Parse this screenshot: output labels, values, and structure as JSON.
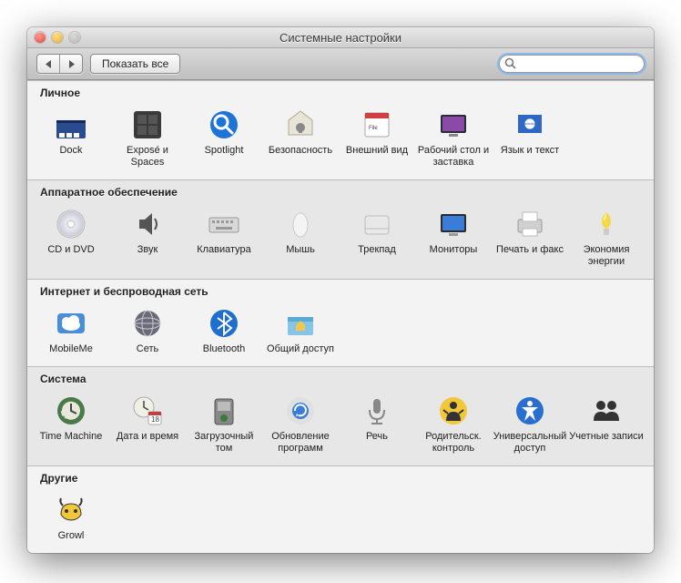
{
  "window": {
    "title": "Системные настройки"
  },
  "toolbar": {
    "showAll": "Показать все",
    "searchPlaceholder": ""
  },
  "sections": {
    "personal": {
      "title": "Личное",
      "items": [
        {
          "id": "dock",
          "label": "Dock"
        },
        {
          "id": "expose",
          "label": "Exposé и Spaces"
        },
        {
          "id": "spotlight",
          "label": "Spotlight"
        },
        {
          "id": "security",
          "label": "Безопасность"
        },
        {
          "id": "appearance",
          "label": "Внешний вид"
        },
        {
          "id": "desktop",
          "label": "Рабочий стол и заставка"
        },
        {
          "id": "language",
          "label": "Язык и текст"
        }
      ]
    },
    "hardware": {
      "title": "Аппаратное обеспечение",
      "items": [
        {
          "id": "cddvd",
          "label": "CD и DVD"
        },
        {
          "id": "sound",
          "label": "Звук"
        },
        {
          "id": "keyboard",
          "label": "Клавиатура"
        },
        {
          "id": "mouse",
          "label": "Мышь"
        },
        {
          "id": "trackpad",
          "label": "Трекпад"
        },
        {
          "id": "displays",
          "label": "Мониторы"
        },
        {
          "id": "print",
          "label": "Печать и факс"
        },
        {
          "id": "energy",
          "label": "Экономия энергии"
        }
      ]
    },
    "internet": {
      "title": "Интернет и беспроводная сеть",
      "items": [
        {
          "id": "mobileme",
          "label": "MobileMe"
        },
        {
          "id": "network",
          "label": "Сеть"
        },
        {
          "id": "bluetooth",
          "label": "Bluetooth"
        },
        {
          "id": "sharing",
          "label": "Общий доступ"
        }
      ]
    },
    "system": {
      "title": "Система",
      "items": [
        {
          "id": "timemachine",
          "label": "Time Machine"
        },
        {
          "id": "datetime",
          "label": "Дата и время"
        },
        {
          "id": "startup",
          "label": "Загрузочный том"
        },
        {
          "id": "update",
          "label": "Обновление программ"
        },
        {
          "id": "speech",
          "label": "Речь"
        },
        {
          "id": "parental",
          "label": "Родительск. контроль"
        },
        {
          "id": "accessibility",
          "label": "Универсальный доступ"
        },
        {
          "id": "accounts",
          "label": "Учетные записи"
        }
      ]
    },
    "other": {
      "title": "Другие",
      "items": [
        {
          "id": "growl",
          "label": "Growl"
        }
      ]
    }
  }
}
